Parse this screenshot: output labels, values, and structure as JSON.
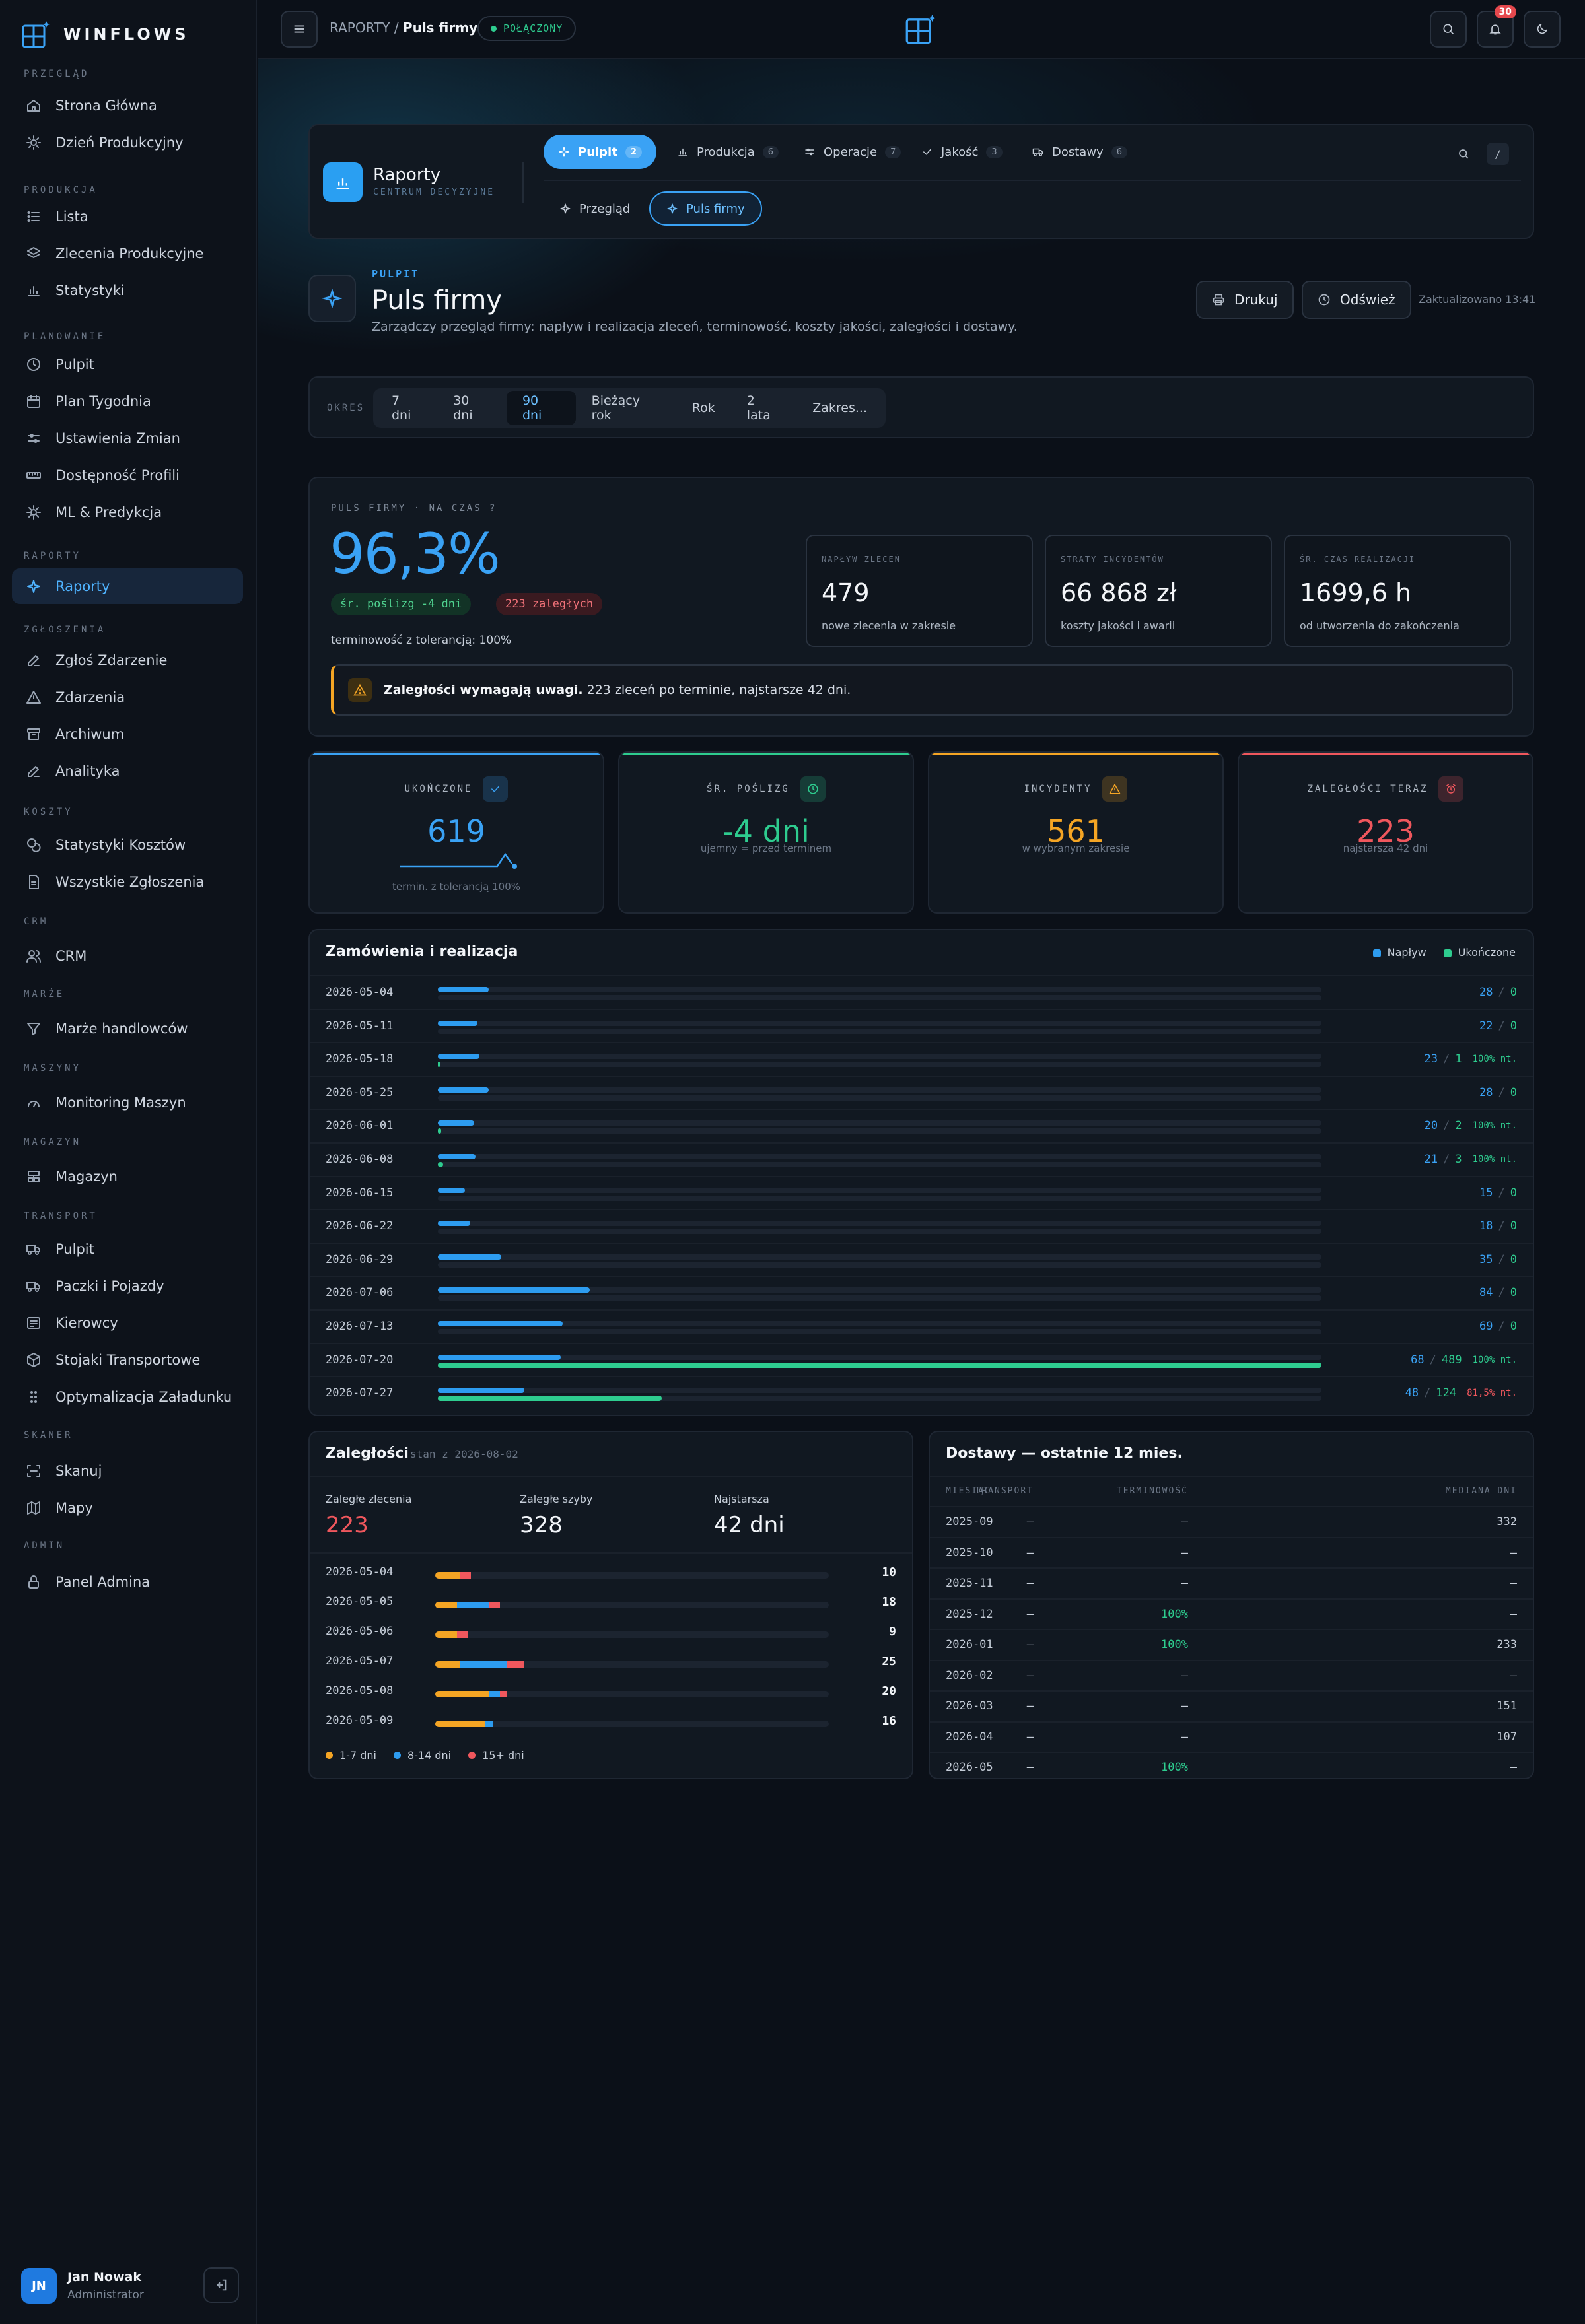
{
  "app": {
    "brand": "WINFLOWS"
  },
  "sidebar": {
    "sections": [
      {
        "label": "PRZEGLĄD",
        "items": [
          {
            "label": "Strona Główna",
            "icon": "home-icon"
          },
          {
            "label": "Dzień Produkcyjny",
            "icon": "sun-icon"
          }
        ]
      },
      {
        "label": "PRODUKCJA",
        "items": [
          {
            "label": "Lista",
            "icon": "list-icon"
          },
          {
            "label": "Zlecenia Produkcyjne",
            "icon": "layers-icon"
          },
          {
            "label": "Statystyki",
            "icon": "bar-chart-icon"
          }
        ]
      },
      {
        "label": "PLANOWANIE",
        "items": [
          {
            "label": "Pulpit",
            "icon": "clock-icon"
          },
          {
            "label": "Plan Tygodnia",
            "icon": "calendar-icon"
          },
          {
            "label": "Ustawienia Zmian",
            "icon": "sliders-icon"
          },
          {
            "label": "Dostępność Profili",
            "icon": "ruler-icon"
          },
          {
            "label": "ML & Predykcja",
            "icon": "cpu-icon"
          }
        ]
      },
      {
        "label": "RAPORTY",
        "items": [
          {
            "label": "Raporty",
            "icon": "sparkle-icon"
          }
        ]
      },
      {
        "label": "ZGŁOSZENIA",
        "items": [
          {
            "label": "Zgłoś Zdarzenie",
            "icon": "pen-icon"
          },
          {
            "label": "Zdarzenia",
            "icon": "warning-icon"
          },
          {
            "label": "Archiwum",
            "icon": "archive-icon"
          },
          {
            "label": "Analityka",
            "icon": "pen-icon"
          }
        ]
      },
      {
        "label": "KOSZTY",
        "items": [
          {
            "label": "Statystyki Kosztów",
            "icon": "coins-icon"
          },
          {
            "label": "Wszystkie Zgłoszenia",
            "icon": "file-icon"
          }
        ]
      },
      {
        "label": "CRM",
        "items": [
          {
            "label": "CRM",
            "icon": "users-icon"
          }
        ]
      },
      {
        "label": "MARŻE",
        "items": [
          {
            "label": "Marże handlowców",
            "icon": "filter-icon"
          }
        ]
      },
      {
        "label": "MASZYNY",
        "items": [
          {
            "label": "Monitoring Maszyn",
            "icon": "gauge-icon"
          }
        ]
      },
      {
        "label": "MAGAZYN",
        "items": [
          {
            "label": "Magazyn",
            "icon": "warehouse-icon"
          }
        ]
      },
      {
        "label": "TRANSPORT",
        "items": [
          {
            "label": "Pulpit",
            "icon": "truck-icon"
          },
          {
            "label": "Paczki i Pojazdy",
            "icon": "truck-icon"
          },
          {
            "label": "Kierowcy",
            "icon": "id-card-icon"
          },
          {
            "label": "Stojaki Transportowe",
            "icon": "box-icon"
          },
          {
            "label": "Optymalizacja Załadunku",
            "icon": "grip-icon"
          }
        ]
      },
      {
        "label": "SKANER",
        "items": [
          {
            "label": "Skanuj",
            "icon": "scan-icon"
          },
          {
            "label": "Mapy",
            "icon": "map-icon"
          }
        ]
      },
      {
        "label": "ADMIN",
        "items": [
          {
            "label": "Panel Admina",
            "icon": "lock-icon"
          }
        ]
      }
    ],
    "active_item": "Raporty",
    "user": {
      "initials": "JN",
      "name": "Jan Nowak",
      "role": "Administrator"
    }
  },
  "topbar": {
    "crumb_parent": "RAPORTY",
    "crumb_sep": "/",
    "crumb_current": "Puls firmy",
    "status": "POŁĄCZONY",
    "notifications": "30"
  },
  "reports_header": {
    "title": "Raporty",
    "subtitle": "CENTRUM DECYZYJNE",
    "tabs": [
      {
        "label": "Pulpit",
        "count": "2",
        "icon": "sparkle-icon",
        "active": true
      },
      {
        "label": "Produkcja",
        "count": "6",
        "icon": "bar-chart-icon"
      },
      {
        "label": "Operacje",
        "count": "7",
        "icon": "sliders-icon"
      },
      {
        "label": "Jakość",
        "count": "3",
        "icon": "check-icon"
      },
      {
        "label": "Dostawy",
        "count": "6",
        "icon": "truck-icon"
      }
    ],
    "subtabs": [
      {
        "label": "Przegląd"
      },
      {
        "label": "Puls firmy",
        "active": true
      }
    ],
    "shortcut": "/"
  },
  "page": {
    "eyebrow": "PULPIT",
    "title": "Puls firmy",
    "description": "Zarządczy przegląd firmy: napływ i realizacja zleceń, terminowość, koszty jakości, zaległości i dostawy.",
    "print_label": "Drukuj",
    "refresh_label": "Odśwież",
    "updated": "Zaktualizowano 13:41"
  },
  "period": {
    "label": "OKRES",
    "options": [
      "7 dni",
      "30 dni",
      "90 dni",
      "Bieżący rok",
      "Rok",
      "2 lata",
      "Zakres..."
    ],
    "selected": "90 dni"
  },
  "pulse": {
    "label": "PULS FIRMY · NA CZAS",
    "help": "?",
    "value": "96,3%",
    "chip_delay": "śr. poślizg -4 dni",
    "chip_overdue": "223 zaległych",
    "tolerance": "terminowość z tolerancją: 100%",
    "metrics": [
      {
        "label": "NAPŁYW ZLECEŃ",
        "value": "479",
        "sub": "nowe zlecenia w zakresie"
      },
      {
        "label": "STRATY INCYDENTÓW",
        "value": "66 868 zł",
        "sub": "koszty jakości i awarii"
      },
      {
        "label": "ŚR. CZAS REALIZACJI",
        "value": "1699,6 h",
        "sub": "od utworzenia do zakończenia"
      }
    ],
    "alert_bold": "Zaległości wymagają uwagi.",
    "alert_text": "223 zleceń po terminie, najstarsze 42 dni."
  },
  "kpis": [
    {
      "label": "UKOŃCZONE",
      "value": "619",
      "sub": "termin. z tolerancją 100%",
      "color": "#3aa2f5",
      "icon": "check-icon"
    },
    {
      "label": "ŚR. POŚLIZG",
      "value": "-4 dni",
      "sub": "ujemny = przed terminem",
      "color": "#2ecc8f",
      "icon": "clock-icon"
    },
    {
      "label": "INCYDENTY",
      "value": "561",
      "sub": "w wybranym zakresie",
      "color": "#f5a524",
      "icon": "warning-icon"
    },
    {
      "label": "ZALEGŁOŚCI TERAZ",
      "value": "223",
      "sub": "najstarsza 42 dni",
      "color": "#f0575d",
      "icon": "alarm-icon"
    }
  ],
  "orders": {
    "title": "Zamówienia i realizacja",
    "legend": [
      "Napływ",
      "Ukończone"
    ],
    "colors": {
      "inflow": "#2d9cf0",
      "done": "#2ecc8f"
    },
    "max_value": 489,
    "rows": [
      {
        "date": "2026-05-04",
        "inflow": 28,
        "done": 0,
        "pct": ""
      },
      {
        "date": "2026-05-11",
        "inflow": 22,
        "done": 0,
        "pct": ""
      },
      {
        "date": "2026-05-18",
        "inflow": 23,
        "done": 1,
        "pct": "100% nt."
      },
      {
        "date": "2026-05-25",
        "inflow": 28,
        "done": 0,
        "pct": ""
      },
      {
        "date": "2026-06-01",
        "inflow": 20,
        "done": 2,
        "pct": "100% nt."
      },
      {
        "date": "2026-06-08",
        "inflow": 21,
        "done": 3,
        "pct": "100% nt."
      },
      {
        "date": "2026-06-15",
        "inflow": 15,
        "done": 0,
        "pct": ""
      },
      {
        "date": "2026-06-22",
        "inflow": 18,
        "done": 0,
        "pct": ""
      },
      {
        "date": "2026-06-29",
        "inflow": 35,
        "done": 0,
        "pct": ""
      },
      {
        "date": "2026-07-06",
        "inflow": 84,
        "done": 0,
        "pct": ""
      },
      {
        "date": "2026-07-13",
        "inflow": 69,
        "done": 0,
        "pct": ""
      },
      {
        "date": "2026-07-20",
        "inflow": 68,
        "done": 489,
        "pct": "100% nt."
      },
      {
        "date": "2026-07-27",
        "inflow": 48,
        "done": 124,
        "pct": "81,5% nt."
      }
    ]
  },
  "backlog": {
    "title": "Zaległości",
    "as_of": "stan z 2026-08-02",
    "stats": [
      {
        "label": "Zaległe zlecenia",
        "value": "223",
        "color": "#f0575d"
      },
      {
        "label": "Zaległe szyby",
        "value": "328",
        "color": "#f2f5f9"
      },
      {
        "label": "Najstarsza",
        "value": "42 dni",
        "color": "#f2f5f9"
      }
    ],
    "legend": [
      "1-7 dni",
      "8-14 dni",
      "15+ dni"
    ],
    "colors": [
      "#f5a524",
      "#2d9cf0",
      "#f0575d"
    ],
    "max_total": 110,
    "rows": [
      {
        "date": "2026-05-04",
        "total": "10",
        "seg": [
          7,
          0,
          3
        ]
      },
      {
        "date": "2026-05-05",
        "total": "18",
        "seg": [
          6,
          9,
          3
        ]
      },
      {
        "date": "2026-05-06",
        "total": "9",
        "seg": [
          6,
          0,
          3
        ]
      },
      {
        "date": "2026-05-07",
        "total": "25",
        "seg": [
          7,
          13,
          5
        ]
      },
      {
        "date": "2026-05-08",
        "total": "20",
        "seg": [
          15,
          3,
          2
        ]
      },
      {
        "date": "2026-05-09",
        "total": "16",
        "seg": [
          14,
          2,
          0
        ]
      }
    ]
  },
  "deliveries": {
    "title": "Dostawy — ostatnie 12 mies.",
    "columns": [
      "MIESIĄC",
      "TERMINOWOŚĆ",
      "TRANSPORT",
      "MEDIANA DNI"
    ],
    "rows": [
      [
        "2025-09",
        "—",
        "—",
        "332"
      ],
      [
        "2025-10",
        "—",
        "—",
        "—"
      ],
      [
        "2025-11",
        "—",
        "—",
        "—"
      ],
      [
        "2025-12",
        "100%",
        "—",
        "—"
      ],
      [
        "2026-01",
        "100%",
        "—",
        "233"
      ],
      [
        "2026-02",
        "—",
        "—",
        "—"
      ],
      [
        "2026-03",
        "—",
        "—",
        "151"
      ],
      [
        "2026-04",
        "—",
        "—",
        "107"
      ],
      [
        "2026-05",
        "100%",
        "—",
        "—"
      ]
    ]
  }
}
